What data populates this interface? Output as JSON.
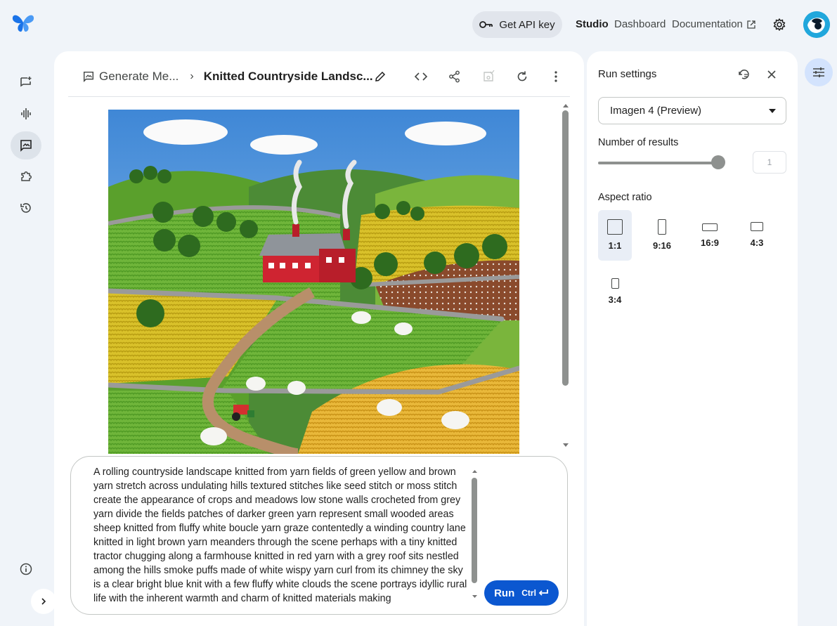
{
  "header": {
    "api_key_label": "Get API key",
    "nav": {
      "studio": "Studio",
      "dashboard": "Dashboard",
      "documentation": "Documentation"
    }
  },
  "breadcrumb": {
    "parent": "Generate Me...",
    "title": "Knitted Countryside Landsc..."
  },
  "prompt": {
    "text": "A rolling countryside landscape knitted from yarn fields of green yellow and brown yarn stretch across undulating hills textured stitches like seed stitch or moss stitch create the appearance of crops and meadows low stone walls crocheted from grey yarn divide the fields patches of darker green yarn represent small wooded areas sheep knitted from fluffy white boucle yarn graze contentedly a winding country lane knitted in light brown yarn meanders through the scene perhaps with a tiny knitted tractor chugging along a farmhouse knitted in red yarn with a grey roof sits nestled among the hills smoke puffs made of white wispy yarn curl from its chimney the sky is a clear bright blue knit with a few fluffy white clouds the scene portrays idyllic rural life with the inherent warmth and charm of knitted materials making",
    "run_label": "Run",
    "run_shortcut": "Ctrl"
  },
  "settings": {
    "title": "Run settings",
    "model": "Imagen 4 (Preview)",
    "results_label": "Number of results",
    "results_value": "1",
    "aspect_label": "Aspect ratio",
    "aspect_ratios": [
      "1:1",
      "9:16",
      "16:9",
      "4:3",
      "3:4"
    ],
    "selected_aspect": "1:1"
  },
  "colors": {
    "accent": "#0b57d0",
    "background": "#f0f4f9",
    "selected": "#e9eef6"
  }
}
